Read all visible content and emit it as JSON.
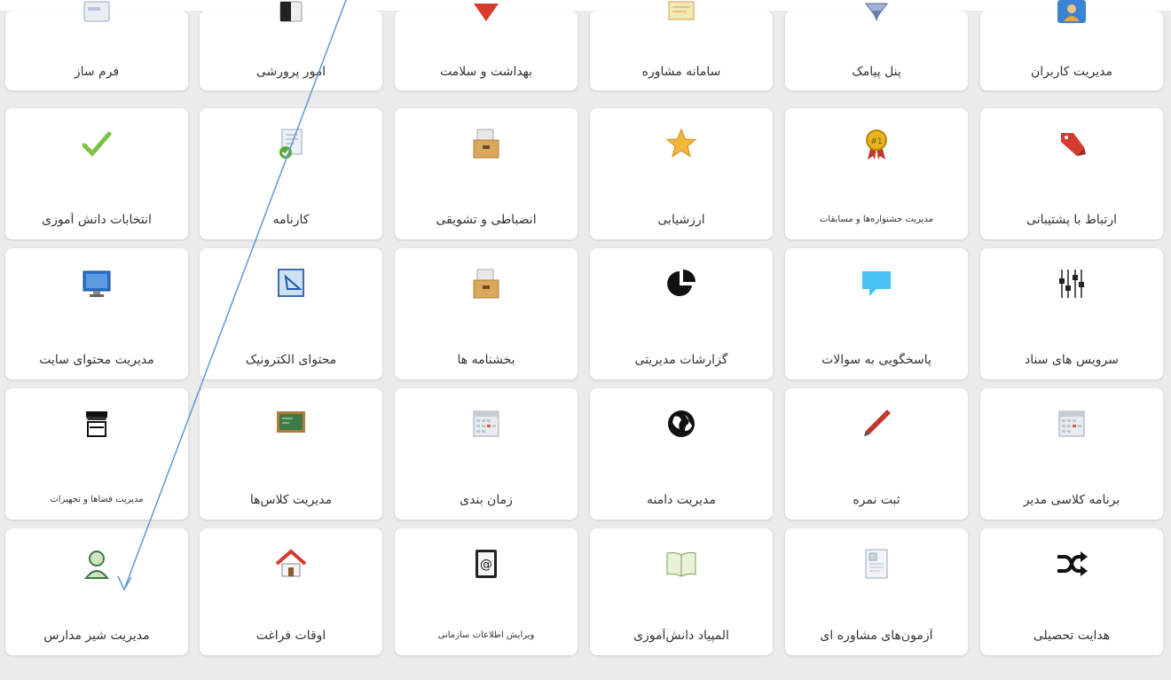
{
  "rows": [
    {
      "tiles": [
        {
          "label": "مدیریت کاربران",
          "icon": "user-folder-icon"
        },
        {
          "label": "پنل پیامک",
          "icon": "sms-icon"
        },
        {
          "label": "سامانه مشاوره",
          "icon": "consult-icon"
        },
        {
          "label": "بهداشت و سلامت",
          "icon": "health-icon"
        },
        {
          "label": "امور پرورشی",
          "icon": "upbringing-icon"
        },
        {
          "label": "فرم ساز",
          "icon": "form-builder-icon"
        }
      ]
    },
    {
      "tiles": [
        {
          "label": "ارتباط با پشتیبانی",
          "icon": "tag-icon"
        },
        {
          "label": "مدیریت جشنواره‌ها و مسابقات",
          "icon": "award-ribbon-icon",
          "small": true
        },
        {
          "label": "ارزشیابی",
          "icon": "star-icon"
        },
        {
          "label": "انضباطی و تشویقی",
          "icon": "archive-box-icon"
        },
        {
          "label": "کارنامه",
          "icon": "report-card-icon"
        },
        {
          "label": "انتخابات دانش آموزی",
          "icon": "checkmark-icon"
        }
      ]
    },
    {
      "tiles": [
        {
          "label": "سرویس های سناد",
          "icon": "sliders-icon"
        },
        {
          "label": "پاسخگویی به سوالات",
          "icon": "speech-bubble-icon"
        },
        {
          "label": "گزارشات مدیریتی",
          "icon": "pie-chart-icon"
        },
        {
          "label": "بخشنامه ها",
          "icon": "archive-box-icon"
        },
        {
          "label": "محتوای الکترونیک",
          "icon": "electronic-content-icon"
        },
        {
          "label": "مدیریت محتوای سایت",
          "icon": "monitor-icon"
        }
      ]
    },
    {
      "tiles": [
        {
          "label": "برنامه کلاسی مدیر",
          "icon": "calendar-icon"
        },
        {
          "label": "ثبت نمره",
          "icon": "pen-icon"
        },
        {
          "label": "مدیریت دامنه",
          "icon": "globe-icon"
        },
        {
          "label": "زمان بندی",
          "icon": "calendar-icon"
        },
        {
          "label": "مدیریت کلاس‌ها",
          "icon": "chalkboard-icon"
        },
        {
          "label": "مدیریت فضاها و تجهیزات",
          "icon": "store-icon",
          "small": true
        }
      ]
    },
    {
      "tiles": [
        {
          "label": "هدایت تحصیلی",
          "icon": "shuffle-icon"
        },
        {
          "label": "آزمون‌های مشاوره ای",
          "icon": "document-icon"
        },
        {
          "label": "المپیاد دانش‌آموزی",
          "icon": "open-book-icon"
        },
        {
          "label": "ویرایش اطلاعات سازمانی",
          "icon": "address-book-icon",
          "small": true
        },
        {
          "label": "اوقات فراغت",
          "icon": "home-icon"
        },
        {
          "label": "مدیریت شیر مدارس",
          "icon": "milk-girl-icon"
        }
      ]
    }
  ],
  "colors": {
    "background": "#ebebeb",
    "tile": "#ffffff",
    "annotation_arrow": "#5b9bd5"
  }
}
